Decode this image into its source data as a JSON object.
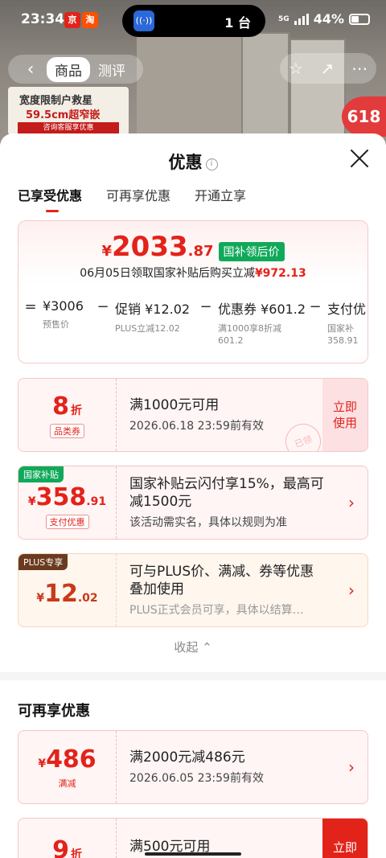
{
  "status_bar": {
    "time": "23:34",
    "island_text": "1 台",
    "network": "5G",
    "battery": "44%"
  },
  "product_nav": {
    "tabs": [
      "商品",
      "测评"
    ],
    "active_tab": "商品"
  },
  "background": {
    "poster_line1": "宽度限制户救星",
    "poster_line2": "59.5cm超窄嵌",
    "poster_line3": "咨询客服享优惠",
    "tag": "618"
  },
  "sheet": {
    "title": "优惠",
    "tabs": [
      "已享受优惠",
      "可再享优惠",
      "开通立享"
    ],
    "active_tab": "已享受优惠"
  },
  "summary": {
    "yen": "¥",
    "price_int": "2033",
    "price_dec": ".87",
    "badge": "国补领后价",
    "claim_text": "06月05日领取国家补贴后购买立减",
    "claim_amount": "¥972.13",
    "breakdown": [
      {
        "op": "=",
        "value": "¥3006",
        "sub": "预售价"
      },
      {
        "op": "−",
        "value": "促销 ¥12.02",
        "sub": "PLUS立减12.02"
      },
      {
        "op": "−",
        "value": "优惠券 ¥601.2",
        "sub": "满1000享8折减 601.2"
      },
      {
        "op": "−",
        "value": "支付优",
        "sub": "国家补 358.91"
      }
    ]
  },
  "coupons": [
    {
      "amount_big": "8",
      "amount_small": "",
      "unit": "折",
      "tag": "品类券",
      "title": "满1000元可用",
      "sub": "2026.06.18 23:59前有效",
      "action": "立即使用",
      "stamp": "已领"
    },
    {
      "corner": "国家补贴",
      "yen": "¥",
      "amount_big": "358",
      "amount_small": ".91",
      "tag": "支付优惠",
      "title": "国家补贴云闪付享15%，最高可减1500元",
      "sub": "该活动需实名，具体以规则为准"
    },
    {
      "corner": "PLUS专享",
      "yen": "¥",
      "amount_big": "12",
      "amount_small": ".02",
      "title": "可与PLUS价、满减、券等优惠叠加使用",
      "sub": "PLUS正式会员可享，具体以结算…"
    }
  ],
  "collapse_label": "收起",
  "more_section": {
    "title": "可再享优惠",
    "coupons": [
      {
        "yen": "¥",
        "amount_big": "486",
        "tag": "满减",
        "title": "满2000元减486元",
        "sub": "2026.06.05 23:59前有效"
      },
      {
        "amount_big": "9",
        "unit": "折",
        "title": "满500元可用",
        "action": "立即"
      }
    ]
  },
  "colors": {
    "accent": "#e2231a",
    "gov_green": "#10a95a",
    "plus_brown": "#6b3b1f"
  }
}
